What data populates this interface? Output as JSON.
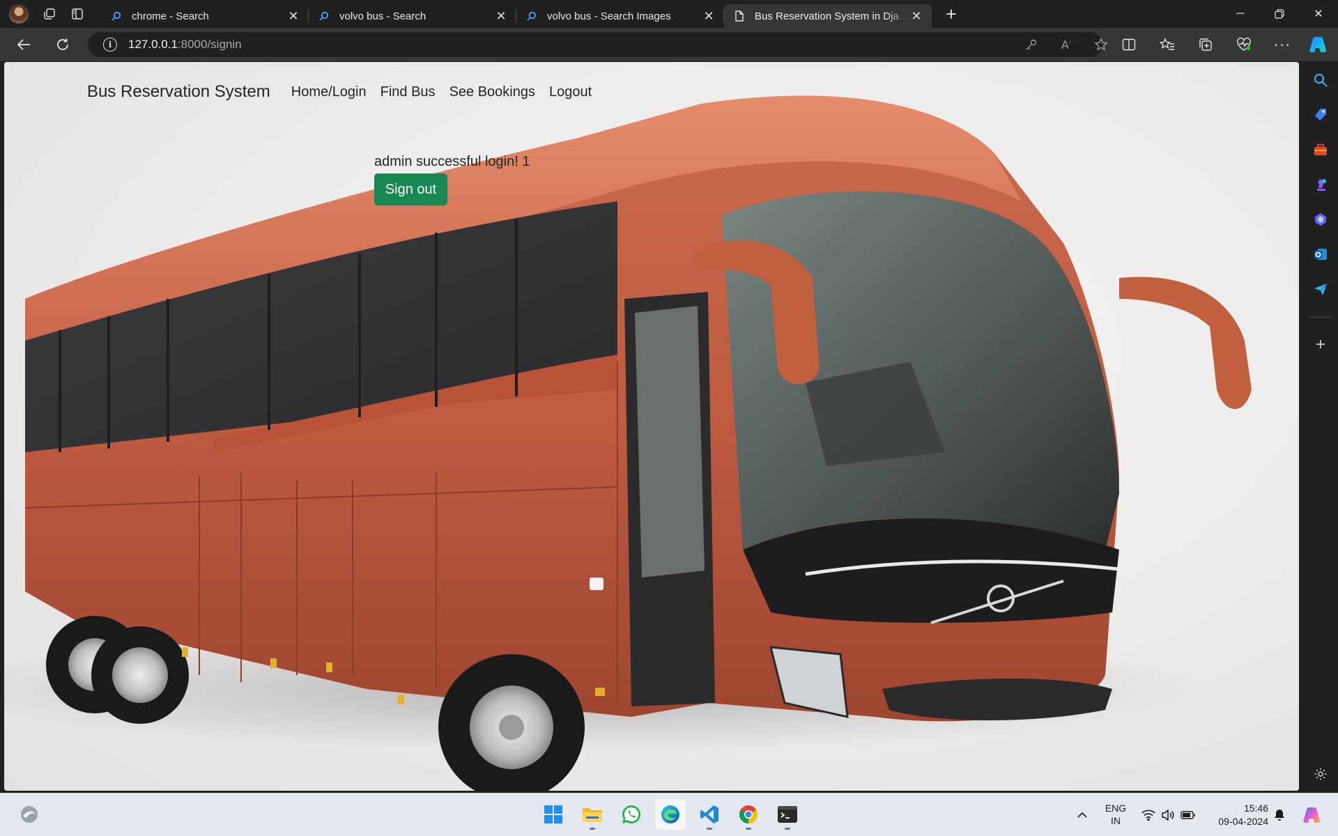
{
  "browser": {
    "tabs": [
      {
        "title": "chrome - Search",
        "icon": "search-icon",
        "active": false
      },
      {
        "title": "volvo bus - Search",
        "icon": "search-icon",
        "active": false
      },
      {
        "title": "volvo bus - Search Images",
        "icon": "search-icon",
        "active": false
      },
      {
        "title": "Bus Reservation System in Django",
        "icon": "page-icon",
        "active": true
      }
    ],
    "url_host": "127.0.0.1",
    "url_path": ":8000/signin",
    "new_tab_glyph": "+"
  },
  "page": {
    "brand": "Bus Reservation System",
    "nav": [
      "Home/Login",
      "Find Bus",
      "See Bookings",
      "Logout"
    ],
    "message": "admin successful login! 1",
    "signout_label": "Sign out",
    "button_color": "#198754",
    "hero_image": "orange-volvo-coach-bus"
  },
  "sidebar": {
    "items": [
      "search-icon",
      "tag-icon",
      "toolbox-icon",
      "chess-icon",
      "copilot-icon",
      "outlook-icon",
      "send-icon",
      "add-icon",
      "settings-icon"
    ]
  },
  "taskbar": {
    "apps": [
      "windows-start-icon",
      "file-explorer-icon",
      "whatsapp-icon",
      "edge-icon",
      "vscode-icon",
      "chrome-icon",
      "terminal-icon"
    ],
    "language": "ENG",
    "region": "IN",
    "time": "15:46",
    "date": "09-04-2024"
  }
}
